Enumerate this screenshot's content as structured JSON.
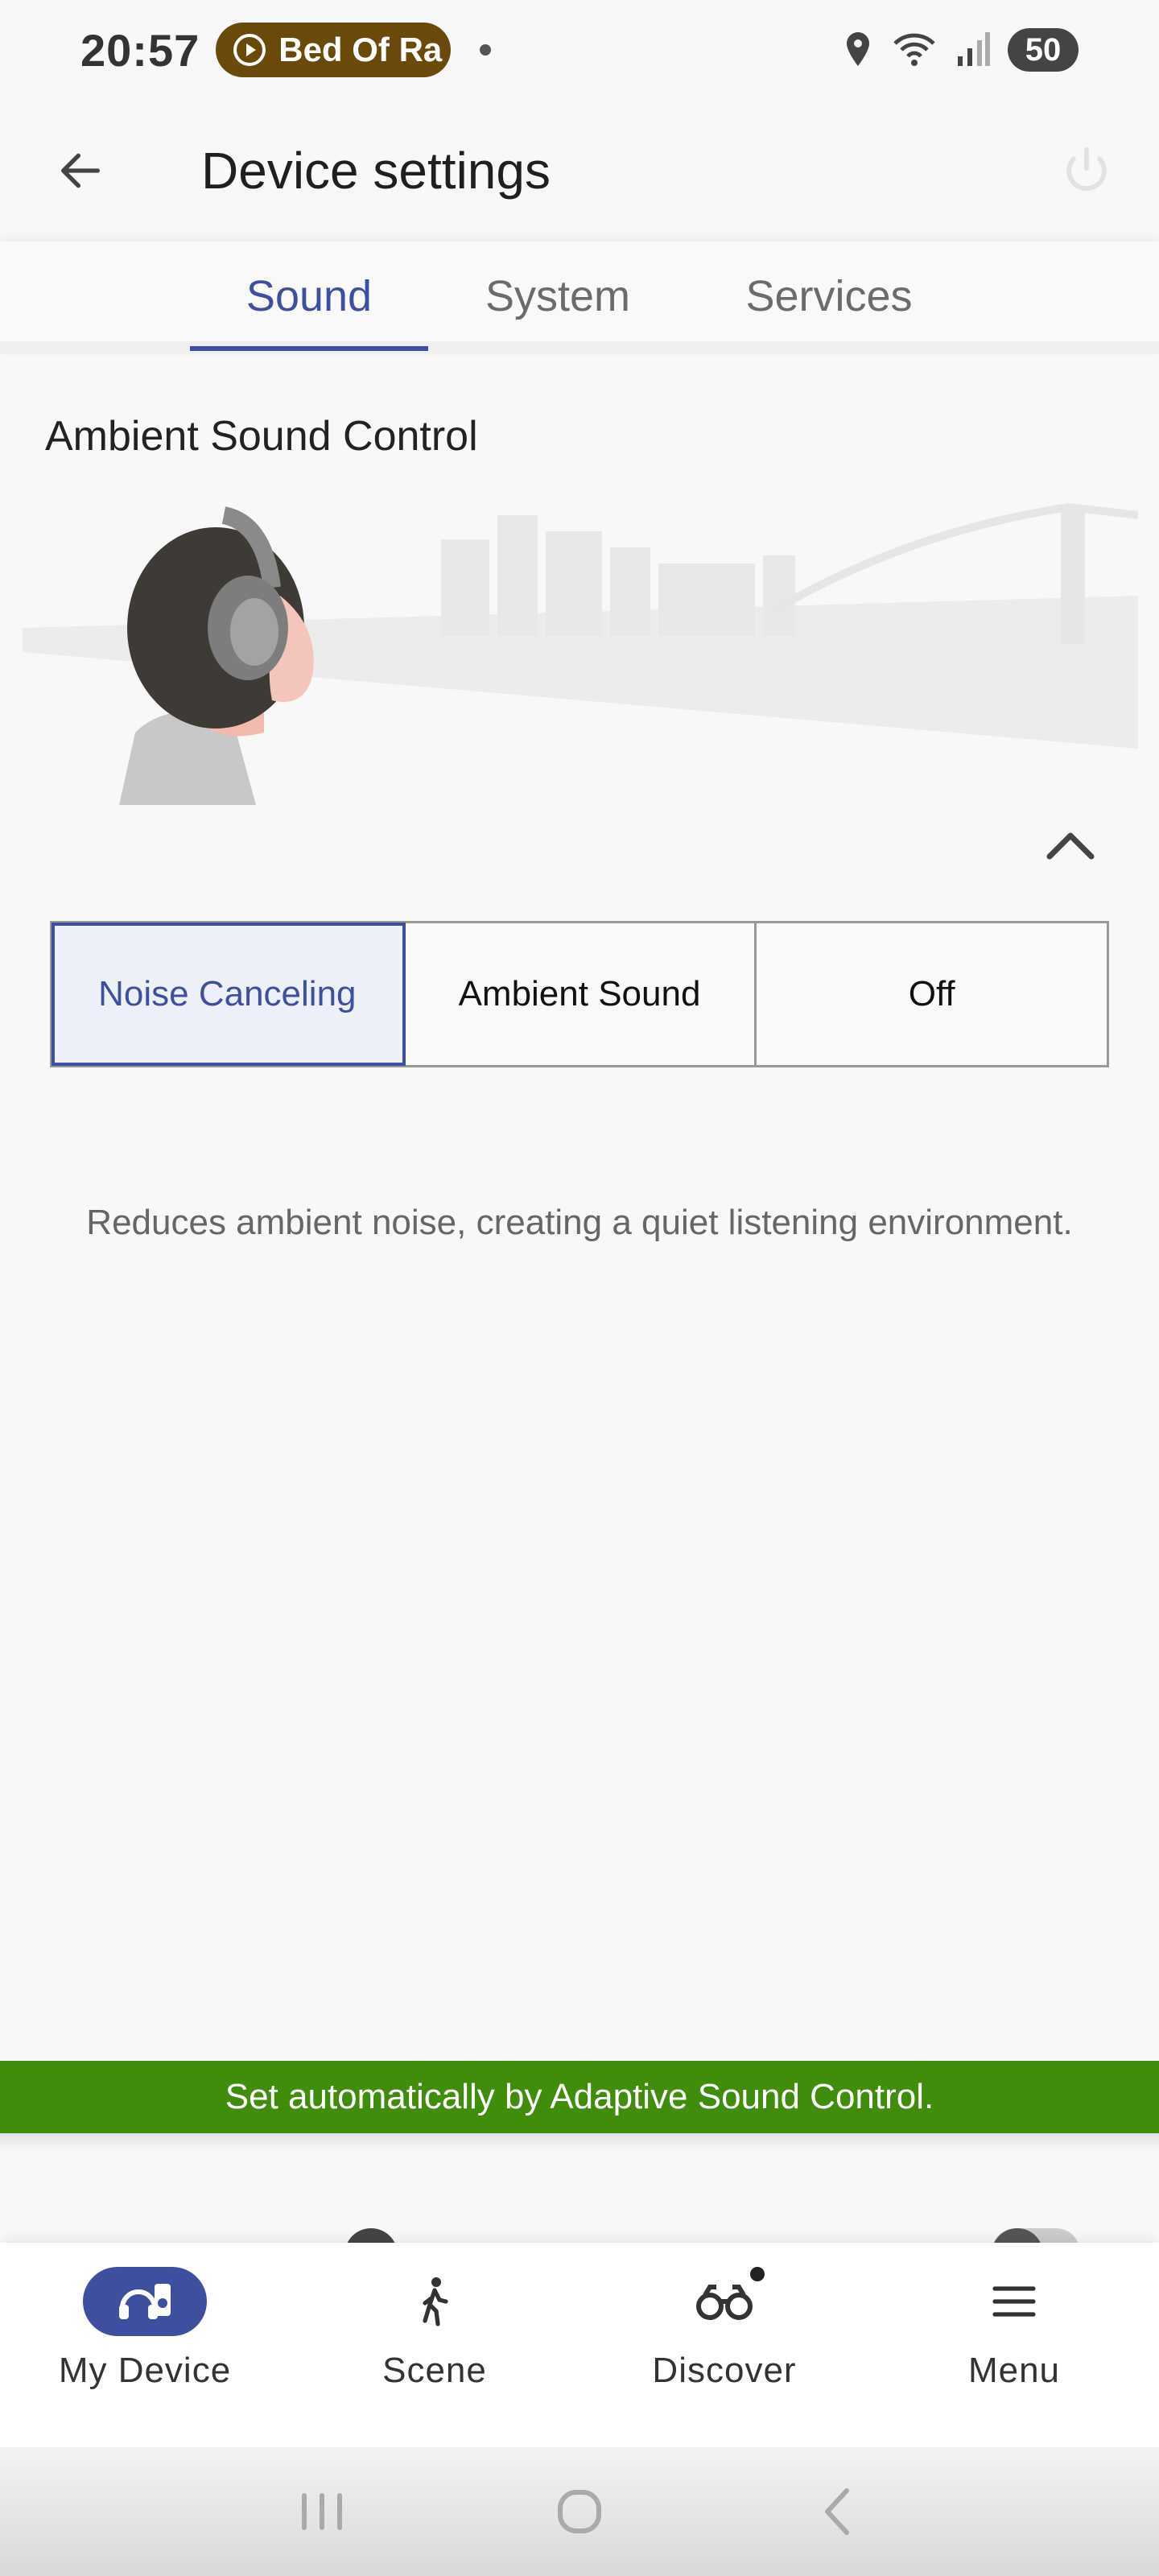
{
  "status_bar": {
    "time": "20:57",
    "media_pill": "Bed Of Ra",
    "battery": "50"
  },
  "header": {
    "title": "Device settings",
    "back_icon": "arrow-left-icon",
    "power_icon": "power-icon"
  },
  "tabs": [
    {
      "label": "Sound",
      "active": true
    },
    {
      "label": "System",
      "active": false
    },
    {
      "label": "Services",
      "active": false
    }
  ],
  "ambient": {
    "section_title": "Ambient Sound Control",
    "modes": [
      {
        "label": "Noise Canceling",
        "selected": true
      },
      {
        "label": "Ambient Sound",
        "selected": false
      },
      {
        "label": "Off",
        "selected": false
      }
    ],
    "description": "Reduces ambient noise, creating a quiet listening environment.",
    "banner": "Set automatically by Adaptive Sound Control."
  },
  "bottom_nav": [
    {
      "label": "My Device",
      "icon": "headphones-speaker-icon",
      "active": true
    },
    {
      "label": "Scene",
      "icon": "walking-person-icon",
      "active": false
    },
    {
      "label": "Discover",
      "icon": "binoculars-icon",
      "active": false,
      "badge": true
    },
    {
      "label": "Menu",
      "icon": "hamburger-menu-icon",
      "active": false
    }
  ],
  "colors": {
    "accent": "#3e4fa0",
    "banner_green": "#3f8d0b",
    "media_pill": "#6a4a0a"
  }
}
